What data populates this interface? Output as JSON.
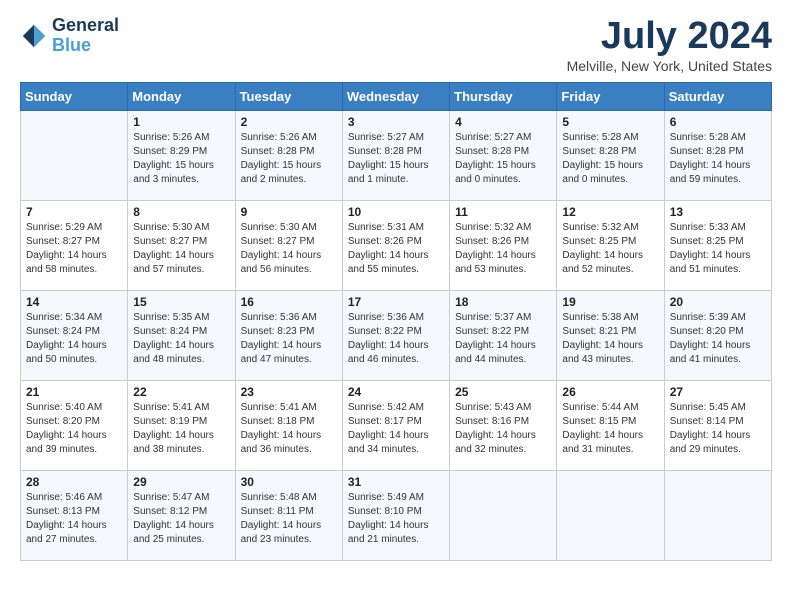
{
  "logo": {
    "line1": "General",
    "line2": "Blue"
  },
  "title": "July 2024",
  "location": "Melville, New York, United States",
  "days_of_week": [
    "Sunday",
    "Monday",
    "Tuesday",
    "Wednesday",
    "Thursday",
    "Friday",
    "Saturday"
  ],
  "weeks": [
    [
      {
        "day": "",
        "sunrise": "",
        "sunset": "",
        "daylight": ""
      },
      {
        "day": "1",
        "sunrise": "Sunrise: 5:26 AM",
        "sunset": "Sunset: 8:29 PM",
        "daylight": "Daylight: 15 hours and 3 minutes."
      },
      {
        "day": "2",
        "sunrise": "Sunrise: 5:26 AM",
        "sunset": "Sunset: 8:28 PM",
        "daylight": "Daylight: 15 hours and 2 minutes."
      },
      {
        "day": "3",
        "sunrise": "Sunrise: 5:27 AM",
        "sunset": "Sunset: 8:28 PM",
        "daylight": "Daylight: 15 hours and 1 minute."
      },
      {
        "day": "4",
        "sunrise": "Sunrise: 5:27 AM",
        "sunset": "Sunset: 8:28 PM",
        "daylight": "Daylight: 15 hours and 0 minutes."
      },
      {
        "day": "5",
        "sunrise": "Sunrise: 5:28 AM",
        "sunset": "Sunset: 8:28 PM",
        "daylight": "Daylight: 15 hours and 0 minutes."
      },
      {
        "day": "6",
        "sunrise": "Sunrise: 5:28 AM",
        "sunset": "Sunset: 8:28 PM",
        "daylight": "Daylight: 14 hours and 59 minutes."
      }
    ],
    [
      {
        "day": "7",
        "sunrise": "Sunrise: 5:29 AM",
        "sunset": "Sunset: 8:27 PM",
        "daylight": "Daylight: 14 hours and 58 minutes."
      },
      {
        "day": "8",
        "sunrise": "Sunrise: 5:30 AM",
        "sunset": "Sunset: 8:27 PM",
        "daylight": "Daylight: 14 hours and 57 minutes."
      },
      {
        "day": "9",
        "sunrise": "Sunrise: 5:30 AM",
        "sunset": "Sunset: 8:27 PM",
        "daylight": "Daylight: 14 hours and 56 minutes."
      },
      {
        "day": "10",
        "sunrise": "Sunrise: 5:31 AM",
        "sunset": "Sunset: 8:26 PM",
        "daylight": "Daylight: 14 hours and 55 minutes."
      },
      {
        "day": "11",
        "sunrise": "Sunrise: 5:32 AM",
        "sunset": "Sunset: 8:26 PM",
        "daylight": "Daylight: 14 hours and 53 minutes."
      },
      {
        "day": "12",
        "sunrise": "Sunrise: 5:32 AM",
        "sunset": "Sunset: 8:25 PM",
        "daylight": "Daylight: 14 hours and 52 minutes."
      },
      {
        "day": "13",
        "sunrise": "Sunrise: 5:33 AM",
        "sunset": "Sunset: 8:25 PM",
        "daylight": "Daylight: 14 hours and 51 minutes."
      }
    ],
    [
      {
        "day": "14",
        "sunrise": "Sunrise: 5:34 AM",
        "sunset": "Sunset: 8:24 PM",
        "daylight": "Daylight: 14 hours and 50 minutes."
      },
      {
        "day": "15",
        "sunrise": "Sunrise: 5:35 AM",
        "sunset": "Sunset: 8:24 PM",
        "daylight": "Daylight: 14 hours and 48 minutes."
      },
      {
        "day": "16",
        "sunrise": "Sunrise: 5:36 AM",
        "sunset": "Sunset: 8:23 PM",
        "daylight": "Daylight: 14 hours and 47 minutes."
      },
      {
        "day": "17",
        "sunrise": "Sunrise: 5:36 AM",
        "sunset": "Sunset: 8:22 PM",
        "daylight": "Daylight: 14 hours and 46 minutes."
      },
      {
        "day": "18",
        "sunrise": "Sunrise: 5:37 AM",
        "sunset": "Sunset: 8:22 PM",
        "daylight": "Daylight: 14 hours and 44 minutes."
      },
      {
        "day": "19",
        "sunrise": "Sunrise: 5:38 AM",
        "sunset": "Sunset: 8:21 PM",
        "daylight": "Daylight: 14 hours and 43 minutes."
      },
      {
        "day": "20",
        "sunrise": "Sunrise: 5:39 AM",
        "sunset": "Sunset: 8:20 PM",
        "daylight": "Daylight: 14 hours and 41 minutes."
      }
    ],
    [
      {
        "day": "21",
        "sunrise": "Sunrise: 5:40 AM",
        "sunset": "Sunset: 8:20 PM",
        "daylight": "Daylight: 14 hours and 39 minutes."
      },
      {
        "day": "22",
        "sunrise": "Sunrise: 5:41 AM",
        "sunset": "Sunset: 8:19 PM",
        "daylight": "Daylight: 14 hours and 38 minutes."
      },
      {
        "day": "23",
        "sunrise": "Sunrise: 5:41 AM",
        "sunset": "Sunset: 8:18 PM",
        "daylight": "Daylight: 14 hours and 36 minutes."
      },
      {
        "day": "24",
        "sunrise": "Sunrise: 5:42 AM",
        "sunset": "Sunset: 8:17 PM",
        "daylight": "Daylight: 14 hours and 34 minutes."
      },
      {
        "day": "25",
        "sunrise": "Sunrise: 5:43 AM",
        "sunset": "Sunset: 8:16 PM",
        "daylight": "Daylight: 14 hours and 32 minutes."
      },
      {
        "day": "26",
        "sunrise": "Sunrise: 5:44 AM",
        "sunset": "Sunset: 8:15 PM",
        "daylight": "Daylight: 14 hours and 31 minutes."
      },
      {
        "day": "27",
        "sunrise": "Sunrise: 5:45 AM",
        "sunset": "Sunset: 8:14 PM",
        "daylight": "Daylight: 14 hours and 29 minutes."
      }
    ],
    [
      {
        "day": "28",
        "sunrise": "Sunrise: 5:46 AM",
        "sunset": "Sunset: 8:13 PM",
        "daylight": "Daylight: 14 hours and 27 minutes."
      },
      {
        "day": "29",
        "sunrise": "Sunrise: 5:47 AM",
        "sunset": "Sunset: 8:12 PM",
        "daylight": "Daylight: 14 hours and 25 minutes."
      },
      {
        "day": "30",
        "sunrise": "Sunrise: 5:48 AM",
        "sunset": "Sunset: 8:11 PM",
        "daylight": "Daylight: 14 hours and 23 minutes."
      },
      {
        "day": "31",
        "sunrise": "Sunrise: 5:49 AM",
        "sunset": "Sunset: 8:10 PM",
        "daylight": "Daylight: 14 hours and 21 minutes."
      },
      {
        "day": "",
        "sunrise": "",
        "sunset": "",
        "daylight": ""
      },
      {
        "day": "",
        "sunrise": "",
        "sunset": "",
        "daylight": ""
      },
      {
        "day": "",
        "sunrise": "",
        "sunset": "",
        "daylight": ""
      }
    ]
  ]
}
